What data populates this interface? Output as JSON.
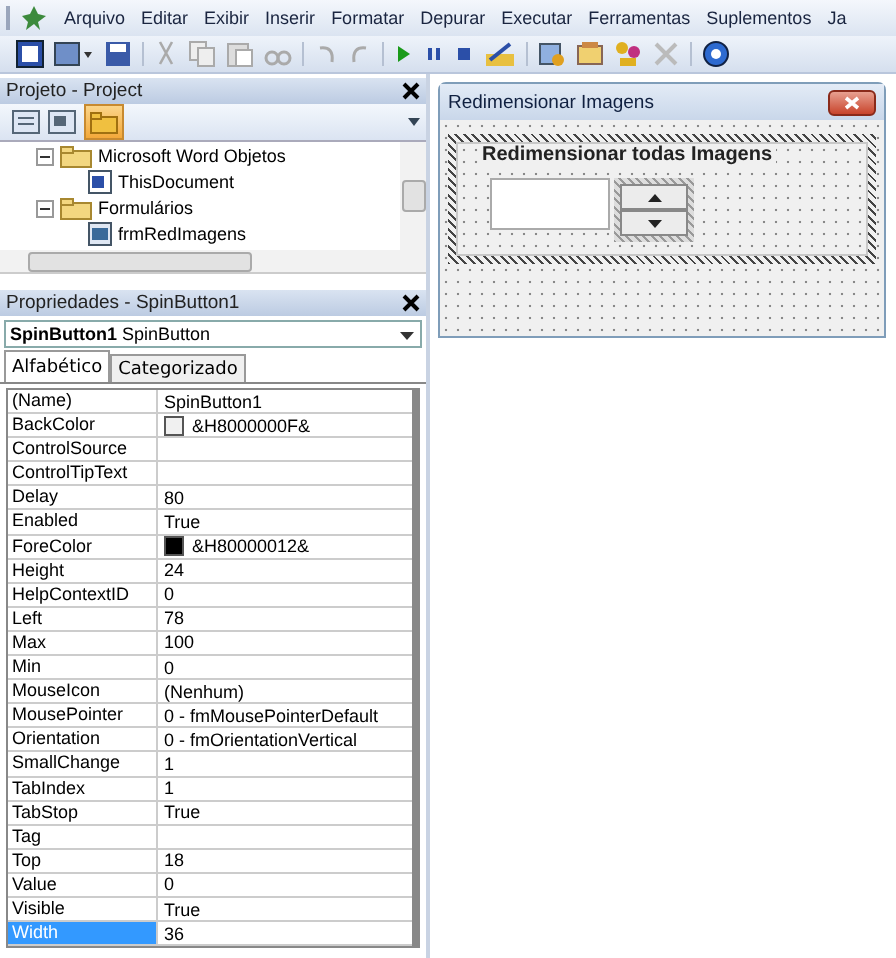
{
  "menu": [
    "Arquivo",
    "Editar",
    "Exibir",
    "Inserir",
    "Formatar",
    "Depurar",
    "Executar",
    "Ferramentas",
    "Suplementos",
    "Ja"
  ],
  "project": {
    "title": "Projeto - Project",
    "tree": [
      {
        "label": "Microsoft Word Objetos",
        "kind": "folder",
        "expanded": true,
        "children": [
          {
            "label": "ThisDocument",
            "kind": "document"
          }
        ]
      },
      {
        "label": "Formulários",
        "kind": "folder",
        "expanded": true,
        "children": [
          {
            "label": "frmRedImagens",
            "kind": "form"
          }
        ]
      }
    ]
  },
  "properties": {
    "title": "Propriedades - SpinButton1",
    "object": "**SpinButton1** SpinButton",
    "tabs": [
      {
        "label": "Alfabético",
        "selected": true
      },
      {
        "label": "Categorizado",
        "selected": false
      }
    ],
    "rows": [
      {
        "name": "(Name)",
        "value": "SpinButton1",
        "selected": false
      },
      {
        "name": "BackColor",
        "value": "&H8000000F&",
        "color": "#f0f0f0",
        "selected": false
      },
      {
        "name": "ControlSource",
        "value": "",
        "selected": false
      },
      {
        "name": "ControlTipText",
        "value": "",
        "selected": false
      },
      {
        "name": "Delay",
        "value": "80",
        "selected": false
      },
      {
        "name": "Enabled",
        "value": "True",
        "selected": false
      },
      {
        "name": "ForeColor",
        "value": "&H80000012&",
        "color": "#000000",
        "selected": false
      },
      {
        "name": "Height",
        "value": "24",
        "selected": false
      },
      {
        "name": "HelpContextID",
        "value": "0",
        "selected": false
      },
      {
        "name": "Left",
        "value": "78",
        "selected": false
      },
      {
        "name": "Max",
        "value": "100",
        "selected": false
      },
      {
        "name": "Min",
        "value": "0",
        "selected": false
      },
      {
        "name": "MouseIcon",
        "value": "(Nenhum)",
        "selected": false
      },
      {
        "name": "MousePointer",
        "value": "0 - fmMousePointerDefault",
        "selected": false
      },
      {
        "name": "Orientation",
        "value": "0 - fmOrientationVertical",
        "selected": false
      },
      {
        "name": "SmallChange",
        "value": "1",
        "selected": false
      },
      {
        "name": "TabIndex",
        "value": "1",
        "selected": false
      },
      {
        "name": "TabStop",
        "value": "True",
        "selected": false
      },
      {
        "name": "Tag",
        "value": "",
        "selected": false
      },
      {
        "name": "Top",
        "value": "18",
        "selected": false
      },
      {
        "name": "Value",
        "value": "0",
        "selected": false
      },
      {
        "name": "Visible",
        "value": "True",
        "selected": false
      },
      {
        "name": "Width",
        "value": "36",
        "selected": true
      }
    ]
  },
  "form": {
    "title": "Redimensionar Imagens",
    "frame_caption": "Redimensionar todas Imagens"
  }
}
